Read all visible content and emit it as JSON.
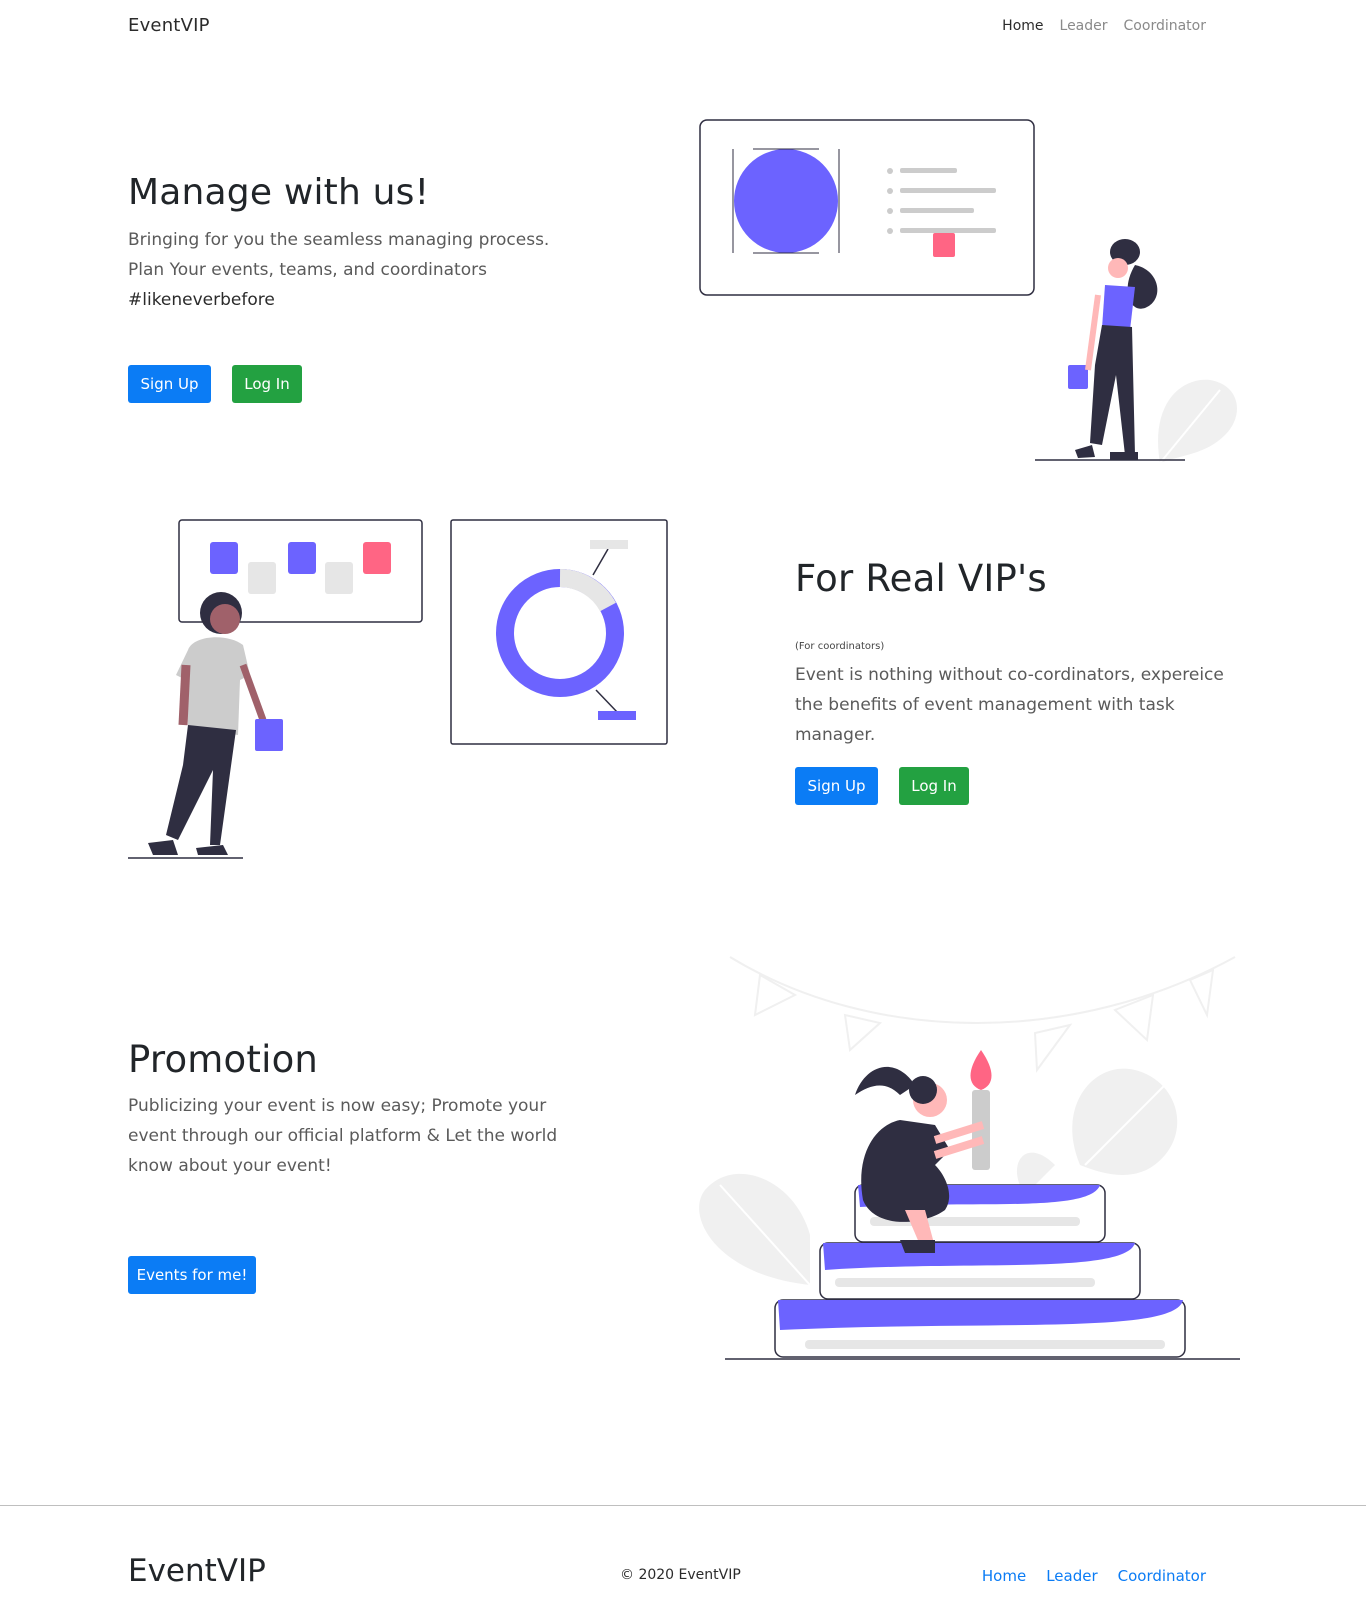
{
  "nav": {
    "brand": "EventVIP",
    "links": [
      "Home",
      "Leader",
      "Coordinator"
    ]
  },
  "hero": {
    "title": "Manage with us!",
    "line1": "Bringing for you the seamless managing process.",
    "line2": "Plan Your events, teams, and coordinators",
    "hashtag": "#likeneverbefore",
    "signup": "Sign Up",
    "login": "Log In"
  },
  "vip": {
    "title": "For Real VIP's",
    "note": "(For coordinators)",
    "line1": "Event is nothing without co-cordinators, expereice",
    "line2": "the benefits of event management with task",
    "line3": "manager.",
    "signup": "Sign Up",
    "login": "Log In"
  },
  "promo": {
    "title": "Promotion",
    "line1": "Publicizing your event is now easy; Promote your",
    "line2": "event through our official platform & Let the world",
    "line3": "know about your event!",
    "button": "Events for me!"
  },
  "footer": {
    "brand": "EventVIP",
    "copyright": "© 2020 EventVIP",
    "links": [
      "Home",
      "Leader",
      "Coordinator"
    ]
  },
  "colors": {
    "primary": "#0b7cf5",
    "success": "#23a141",
    "accent_purple": "#6c63ff",
    "accent_pink": "#ff6584",
    "dark": "#2f2e41"
  }
}
